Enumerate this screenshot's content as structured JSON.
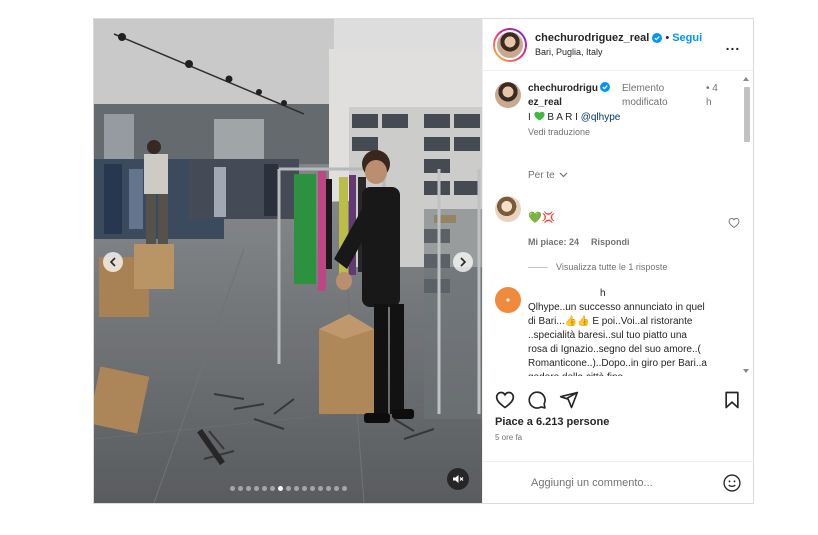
{
  "header": {
    "username": "chechurodriguez_real",
    "separator": "•",
    "follow_label": "Segui",
    "location": "Bari, Puglia, Italy",
    "more_label": "..."
  },
  "caption": {
    "username_line1": "chechurodrigu",
    "username_line2": "ez_real",
    "edited_line1": "Elemento",
    "edited_line2": "modificato",
    "time_prefix": "•",
    "time_value": "4",
    "time_unit": "h",
    "text_prefix": "I",
    "text_spaced": "B A R I",
    "mention": "@qlhype",
    "see_translation": "Vedi traduzione"
  },
  "per_te": "Per te",
  "comments": [
    {
      "text": "💚💢",
      "likes": "Mi piace: 24",
      "reply": "Rispondi",
      "view_replies": "Visualizza tutte le 1 risposte"
    },
    {
      "username": "h",
      "text": "Qlhype..un successo annunciato in quel di Bari...👍👍 E poi..Voi..al ristorante ..specialità baresi..sul tuo piatto una rosa di Ignazio..segno del suo amore..( Romanticone..)..Dopo..in giro per Bari..a godere della città fino"
    }
  ],
  "actions": {
    "like_icon": "heart-icon",
    "comment_icon": "comment-icon",
    "share_icon": "share-icon",
    "save_icon": "bookmark-icon"
  },
  "likes_text": "Piace a 6.213 persone",
  "post_time": "5 ore fa",
  "comment_box": {
    "placeholder": "Aggiungi un commento..."
  },
  "carousel": {
    "total": 15,
    "active_index": 6
  },
  "colors": {
    "accent": "#0095f6",
    "muted": "#737373",
    "border": "#dbdbdb"
  }
}
